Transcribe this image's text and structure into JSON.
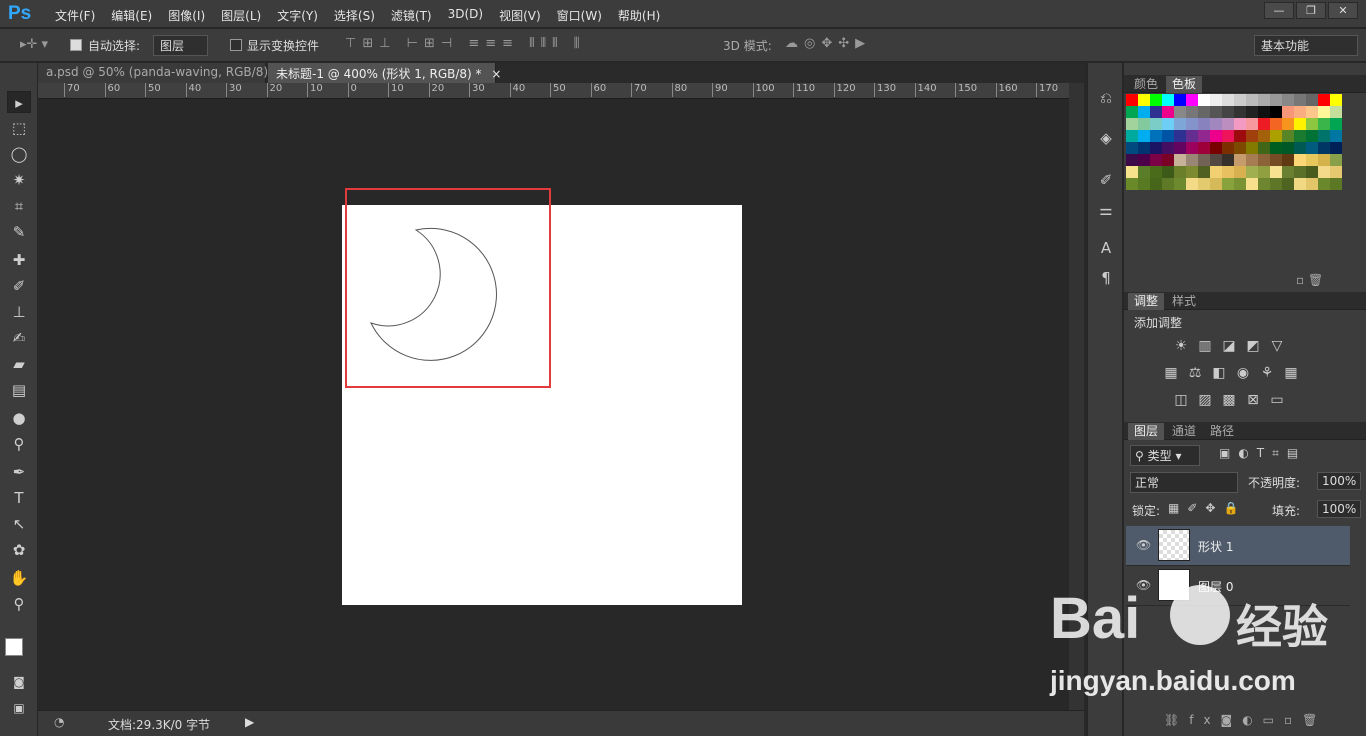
{
  "app": {
    "logo": "Ps"
  },
  "menu": [
    "文件(F)",
    "编辑(E)",
    "图像(I)",
    "图层(L)",
    "文字(Y)",
    "选择(S)",
    "滤镜(T)",
    "3D(D)",
    "视图(V)",
    "窗口(W)",
    "帮助(H)"
  ],
  "window_controls": {
    "minimize": "—",
    "restore": "❐",
    "close": "✕"
  },
  "options": {
    "auto_select_label": "自动选择:",
    "auto_select_value": "图层",
    "show_transform_label": "显示变换控件",
    "mode_3d_label": "3D 模式:",
    "workspace": "基本功能"
  },
  "tabs": [
    {
      "label": "a.psd @ 50% (panda-waving, RGB/8) *",
      "close": "×"
    },
    {
      "label": "未标题-1 @ 400% (形状 1, RGB/8) *",
      "close": "×"
    }
  ],
  "ruler_labels": [
    "70",
    "60",
    "50",
    "40",
    "30",
    "20",
    "10",
    "0",
    "10",
    "20",
    "30",
    "40",
    "50",
    "60",
    "70",
    "80",
    "90",
    "100",
    "110",
    "120",
    "130",
    "140",
    "150",
    "160",
    "170"
  ],
  "status": {
    "doc_size": "文档:29.3K/0 字节"
  },
  "panels": {
    "color_tabs": [
      "颜色",
      "色板"
    ],
    "adjust_tabs": [
      "调整",
      "样式"
    ],
    "add_adjustment": "添加调整",
    "layer_tabs": [
      "图层",
      "通道",
      "路径"
    ],
    "filter_kind": "类型",
    "blend_mode": "正常",
    "opacity_label": "不透明度:",
    "opacity_value": "100%",
    "lock_label": "锁定:",
    "fill_label": "填充:",
    "fill_value": "100%",
    "layers": [
      {
        "name": "形状 1",
        "selected": true
      },
      {
        "name": "图层 0",
        "selected": false
      }
    ]
  },
  "watermark": {
    "brand": "Bai",
    "brand2": "经验",
    "url": "jingyan.baidu.com"
  },
  "colors": {
    "accent": "#31a8ff",
    "highlight": "#e23b3b"
  }
}
